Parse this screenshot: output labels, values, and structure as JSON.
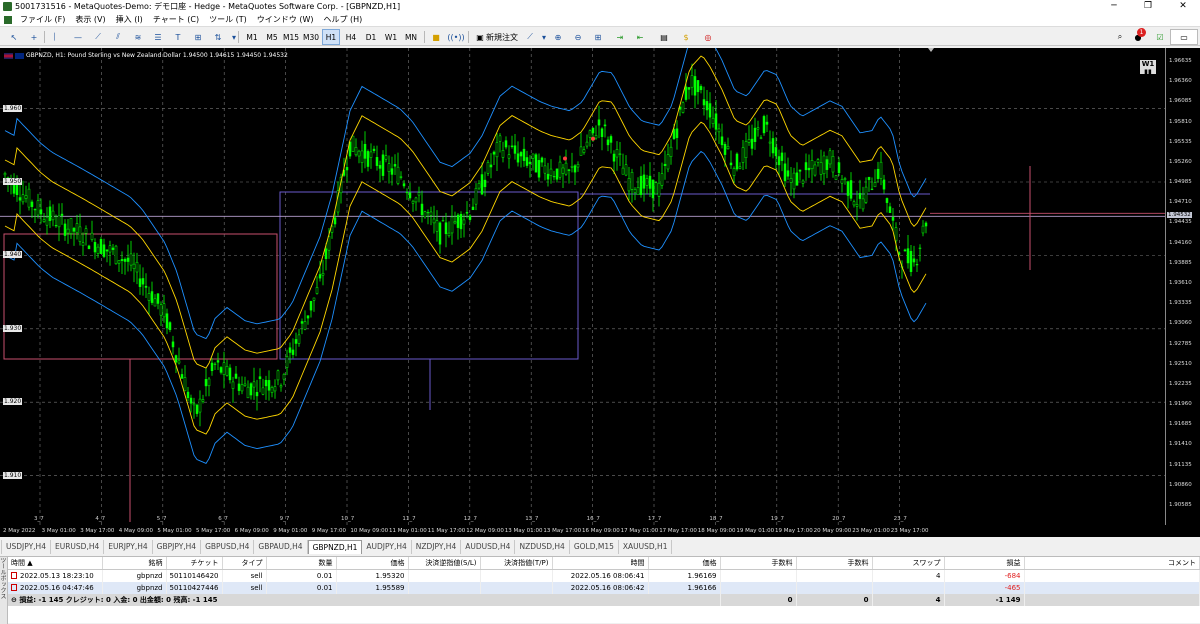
{
  "window": {
    "title": "5001731516 - MetaQuotes-Demo: デモ口座 - Hedge - MetaQuotes Software Corp. - [GBPNZD,H1]",
    "controls": [
      "─",
      "❐",
      "✕"
    ]
  },
  "menu": [
    "ファイル (F)",
    "表示 (V)",
    "挿入 (I)",
    "チャート (C)",
    "ツール (T)",
    "ウインドウ (W)",
    "ヘルプ (H)"
  ],
  "toolbar": {
    "timeframes": [
      "M1",
      "M5",
      "M15",
      "M30",
      "H1",
      "H4",
      "D1",
      "W1",
      "MN"
    ],
    "active_timeframe": "H1",
    "new_order_label": "新規注文",
    "notification_count": "1"
  },
  "chart": {
    "info": "GBPNZD, H1:  Pound Sterling vs New Zealand Dollar  1.94500 1.94615 1.94450 1.94532",
    "period_badge": "W1",
    "left_axis_labels": [
      "1.960",
      "1.950",
      "1.940",
      "1.930",
      "1.920",
      "1.910"
    ],
    "price_scale": [
      "1.96635",
      "1.96360",
      "1.96085",
      "1.95810",
      "1.95535",
      "1.95260",
      "1.94985",
      "1.94710",
      "1.94532",
      "1.94435",
      "1.94160",
      "1.93885",
      "1.93610",
      "1.93335",
      "1.93060",
      "1.92785",
      "1.92510",
      "1.92235",
      "1.91960",
      "1.91685",
      "1.91410",
      "1.91135",
      "1.90860",
      "1.90585"
    ],
    "current_price": "1.94532",
    "time_labels": [
      "2 May 2022",
      "3 May 01:00",
      "3 May 17:00",
      "4 May 09:00",
      "5 May 01:00",
      "5 May 17:00",
      "6 May 09:00",
      "9 May 01:00",
      "9 May 17:00",
      "10 May 09:00",
      "11 May 01:00",
      "11 May 17:00",
      "12 May 09:00",
      "13 May 01:00",
      "13 May 17:00",
      "16 May 09:00",
      "17 May 01:00",
      "17 May 17:00",
      "18 May 09:00",
      "19 May 01:00",
      "19 May 17:00",
      "20 May 09:00",
      "23 May 01:00",
      "23 May 17:00"
    ],
    "day_labels": [
      "3_7",
      "4_7",
      "5_7",
      "6_7",
      "9_7",
      "10_7",
      "11_7",
      "12_7",
      "13_7",
      "16_7",
      "17_7",
      "18_7",
      "19_7",
      "20_7",
      "23_7"
    ],
    "colors": {
      "candle": "#00ff00",
      "band_outer": "#1e90ff",
      "band_inner": "#ffd700",
      "box1": "#c8506e",
      "box2": "#6a5acd",
      "hline": "#b8a0d0"
    }
  },
  "symbol_tabs": [
    "USDJPY,H4",
    "EURUSD,H4",
    "EURJPY,H4",
    "GBPJPY,H4",
    "GBPUSD,H4",
    "GBPAUD,H4",
    "GBPNZD,H1",
    "AUDJPY,H4",
    "NZDJPY,H4",
    "AUDUSD,H4",
    "NZDUSD,H4",
    "GOLD,M15",
    "XAUUSD,H1"
  ],
  "active_tab": "GBPNZD,H1",
  "terminal": {
    "side_label": "ツールボックス",
    "columns": [
      "時間 ▲",
      "銘柄",
      "チケット",
      "タイプ",
      "数量",
      "価格",
      "決済逆指値(S/L)",
      "決済指値(T/P)",
      "時間",
      "価格",
      "手数料",
      "手数料",
      "スワップ",
      "損益",
      "コメント"
    ],
    "rows": [
      [
        "2022.05.13 18:23:10",
        "gbpnzd",
        "50110146420",
        "sell",
        "0.01",
        "1.95320",
        "",
        "",
        "2022.05.16 08:06:41",
        "1.96169",
        "",
        "",
        "4",
        "-684",
        ""
      ],
      [
        "2022.05.16 04:47:46",
        "gbpnzd",
        "50110427446",
        "sell",
        "0.01",
        "1.95589",
        "",
        "",
        "2022.05.16 08:06:42",
        "1.96166",
        "",
        "",
        "",
        "-465",
        ""
      ]
    ],
    "summary": {
      "label": "損益: -1 145  クレジット: 0  入金: 0  出金額: 0  残高: -1 145",
      "c1": "0",
      "c2": "0",
      "swap": "4",
      "pl": "-1 149"
    }
  }
}
